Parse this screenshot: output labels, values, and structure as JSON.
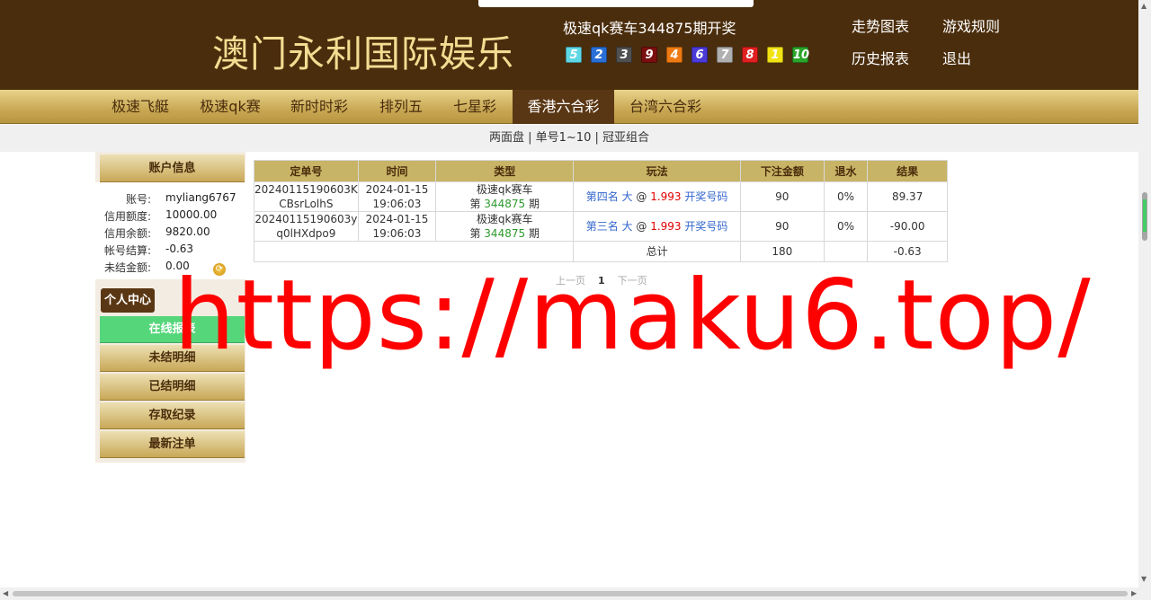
{
  "header": {
    "logo": "澳门永利国际娱乐",
    "draw_title": "极速qk赛车344875期开奖",
    "balls": [
      {
        "num": "5",
        "color": "#5fd8e6"
      },
      {
        "num": "2",
        "color": "#2a6fd6"
      },
      {
        "num": "3",
        "color": "#505050"
      },
      {
        "num": "9",
        "color": "#7a0f0f"
      },
      {
        "num": "4",
        "color": "#ef7a12"
      },
      {
        "num": "6",
        "color": "#4a3ad8"
      },
      {
        "num": "7",
        "color": "#b0b0b0"
      },
      {
        "num": "8",
        "color": "#e02020"
      },
      {
        "num": "1",
        "color": "#f2e214"
      },
      {
        "num": "10",
        "color": "#2aa52a"
      }
    ],
    "links": {
      "trend": "走势图表",
      "rules": "游戏规则",
      "history": "历史报表",
      "logout": "退出"
    }
  },
  "nav": {
    "items": [
      "极速飞艇",
      "极速qk赛",
      "新时时彩",
      "排列五",
      "七星彩",
      "香港六合彩",
      "台湾六合彩"
    ],
    "active_index": 5
  },
  "subnav": {
    "items": [
      "两面盘",
      "单号1~10",
      "冠亚组合"
    ],
    "separator": "|"
  },
  "sidebar": {
    "account_header": "账户信息",
    "account_rows": [
      {
        "label": "账号:",
        "value": "myliang6767"
      },
      {
        "label": "信用额度:",
        "value": "10000.00"
      },
      {
        "label": "信用余额:",
        "value": "9820.00"
      },
      {
        "label": "帐号结算:",
        "value": "-0.63"
      },
      {
        "label": "未结金额:",
        "value": "0.00"
      }
    ],
    "center_tag": "个人中心",
    "menu": [
      "在线报表",
      "未结明细",
      "已结明细",
      "存取纪录",
      "最新注单"
    ],
    "active_menu": 0
  },
  "bets": {
    "columns": [
      "定单号",
      "时间",
      "类型",
      "玩法",
      "下注金额",
      "退水",
      "结果"
    ],
    "rows": [
      {
        "order_line1": "20240115190603K",
        "order_line2": "CBsrLolhS",
        "date": "2024-01-15",
        "time": "19:06:03",
        "type_line1": "极速qk赛车",
        "period_prefix": "第",
        "period": "344875",
        "period_suffix": "期",
        "play_position": "第四名 大",
        "play_at": "@",
        "odds": "1.993",
        "play_link": "开奖号码",
        "amount": "90",
        "rebate": "0%",
        "result": "89.37"
      },
      {
        "order_line1": "20240115190603y",
        "order_line2": "q0lHXdpo9",
        "date": "2024-01-15",
        "time": "19:06:03",
        "type_line1": "极速qk赛车",
        "period_prefix": "第",
        "period": "344875",
        "period_suffix": "期",
        "play_position": "第三名 大",
        "play_at": "@",
        "odds": "1.993",
        "play_link": "开奖号码",
        "amount": "90",
        "rebate": "0%",
        "result": "-90.00"
      }
    ],
    "total": {
      "label": "总计",
      "amount": "180",
      "rebate": "",
      "result": "-0.63"
    }
  },
  "pager": {
    "prev": "上一页",
    "current": "1",
    "next": "下一页"
  },
  "watermark": "https://maku6.top/"
}
